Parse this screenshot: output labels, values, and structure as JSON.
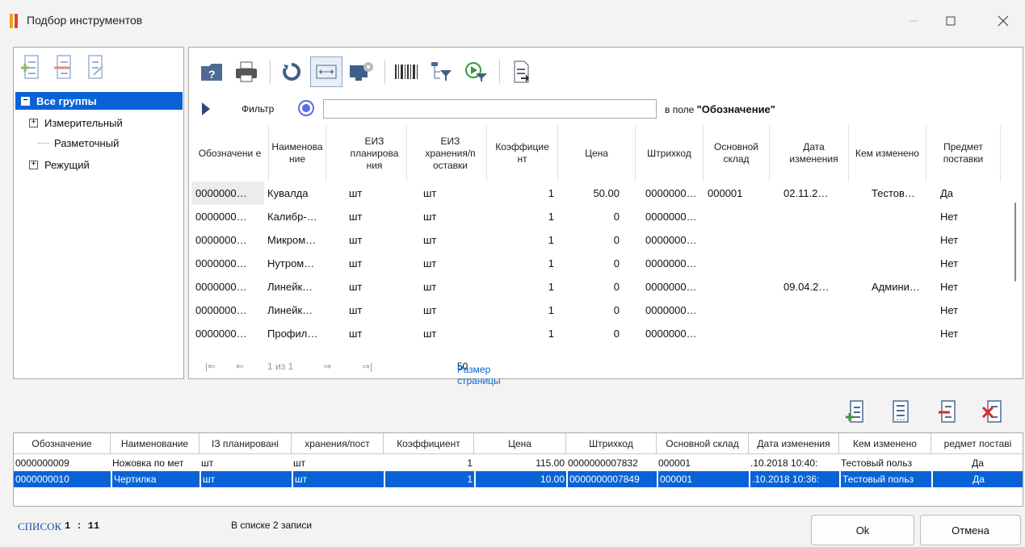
{
  "window": {
    "title": "Подбор инструментов",
    "minimize_icon": "minimize-icon",
    "maximize_icon": "maximize-icon",
    "close_icon": "close-icon"
  },
  "tree": {
    "toolbar_icons": [
      "add-group-icon",
      "remove-group-icon",
      "edit-group-icon"
    ],
    "items": [
      {
        "label": "Все группы",
        "expander": "⊟",
        "selected": true
      },
      {
        "label": "Измерительный",
        "expander": "+"
      },
      {
        "label": "Разметочный",
        "expander": ""
      },
      {
        "label": "Режущий",
        "expander": "+"
      }
    ]
  },
  "toolbar": {
    "icons": [
      "help-icon",
      "print-icon",
      "refresh-icon",
      "fit-columns-icon",
      "settings-icon",
      "barcode-icon",
      "tree-filter-icon",
      "run-filter-icon",
      "export-icon"
    ]
  },
  "filter": {
    "label": "Фильтр",
    "value": "",
    "field_prefix": "в поле",
    "field_name": "\"Обозначение\""
  },
  "catalog": {
    "columns": [
      "Обозначени е",
      "Наименова ние",
      "ЕИЗ планирова ния",
      "ЕИЗ хранения/п оставки",
      "Коэффицие нт",
      "Цена",
      "Штрихкод",
      "Основной склад",
      "Дата изменения",
      "Кем изменено",
      "Предмет поставки"
    ],
    "rows": [
      [
        "0000000…",
        "Кувалда",
        "шт",
        "шт",
        "1",
        "50.00",
        "0000000…",
        "000001",
        "02.11.2…",
        "Тестов…",
        "Да"
      ],
      [
        "0000000…",
        "Калибр-…",
        "шт",
        "шт",
        "1",
        "0",
        "0000000…",
        "",
        "",
        "",
        "Нет"
      ],
      [
        "0000000…",
        "Микром…",
        "шт",
        "шт",
        "1",
        "0",
        "0000000…",
        "",
        "",
        "",
        "Нет"
      ],
      [
        "0000000…",
        "Нутром…",
        "шт",
        "шт",
        "1",
        "0",
        "0000000…",
        "",
        "",
        "",
        "Нет"
      ],
      [
        "0000000…",
        "Линейк…",
        "шт",
        "шт",
        "1",
        "0",
        "0000000…",
        "",
        "09.04.2…",
        "Админи…",
        "Нет"
      ],
      [
        "0000000…",
        "Линейк…",
        "шт",
        "шт",
        "1",
        "0",
        "0000000…",
        "",
        "",
        "",
        "Нет"
      ],
      [
        "0000000…",
        "Профил…",
        "шт",
        "шт",
        "1",
        "0",
        "0000000…",
        "",
        "",
        "",
        "Нет"
      ]
    ]
  },
  "pager": {
    "first": "|⇐",
    "prev": "⇐",
    "page_text": "1 из 1",
    "next": "⇒",
    "last": "⇒|",
    "page_size_label": "Размер страницы",
    "page_size": "50"
  },
  "selected_toolbar_icons": [
    "add-row-icon",
    "insert-rows-icon",
    "remove-row-icon",
    "delete-all-icon"
  ],
  "selected": {
    "columns": [
      "Обозначение",
      "Наименование",
      "ІЗ планировані",
      "хранения/пост",
      "Коэффициент",
      "Цена",
      "Штрихкод",
      "Основной склад",
      "Дата изменения",
      "Кем изменено",
      "редмет поставі"
    ],
    "rows": [
      [
        "0000000009",
        "Ножовка по мет",
        "шт",
        "шт",
        "1",
        "115.00",
        "0000000007832",
        "000001",
        ".10.2018 10:40:",
        "Тестовый польз",
        "Да"
      ],
      [
        "0000000010",
        "Чертилка",
        "шт",
        "шт",
        "1",
        "10.00",
        "0000000007849",
        "000001",
        ".10.2018 10:36:",
        "Тестовый польз",
        "Да"
      ]
    ]
  },
  "status": {
    "mode": "СПИСОК",
    "position": "1 : 11",
    "count": "В списке 2 записи"
  },
  "buttons": {
    "ok": "Ok",
    "cancel": "Отмена"
  }
}
